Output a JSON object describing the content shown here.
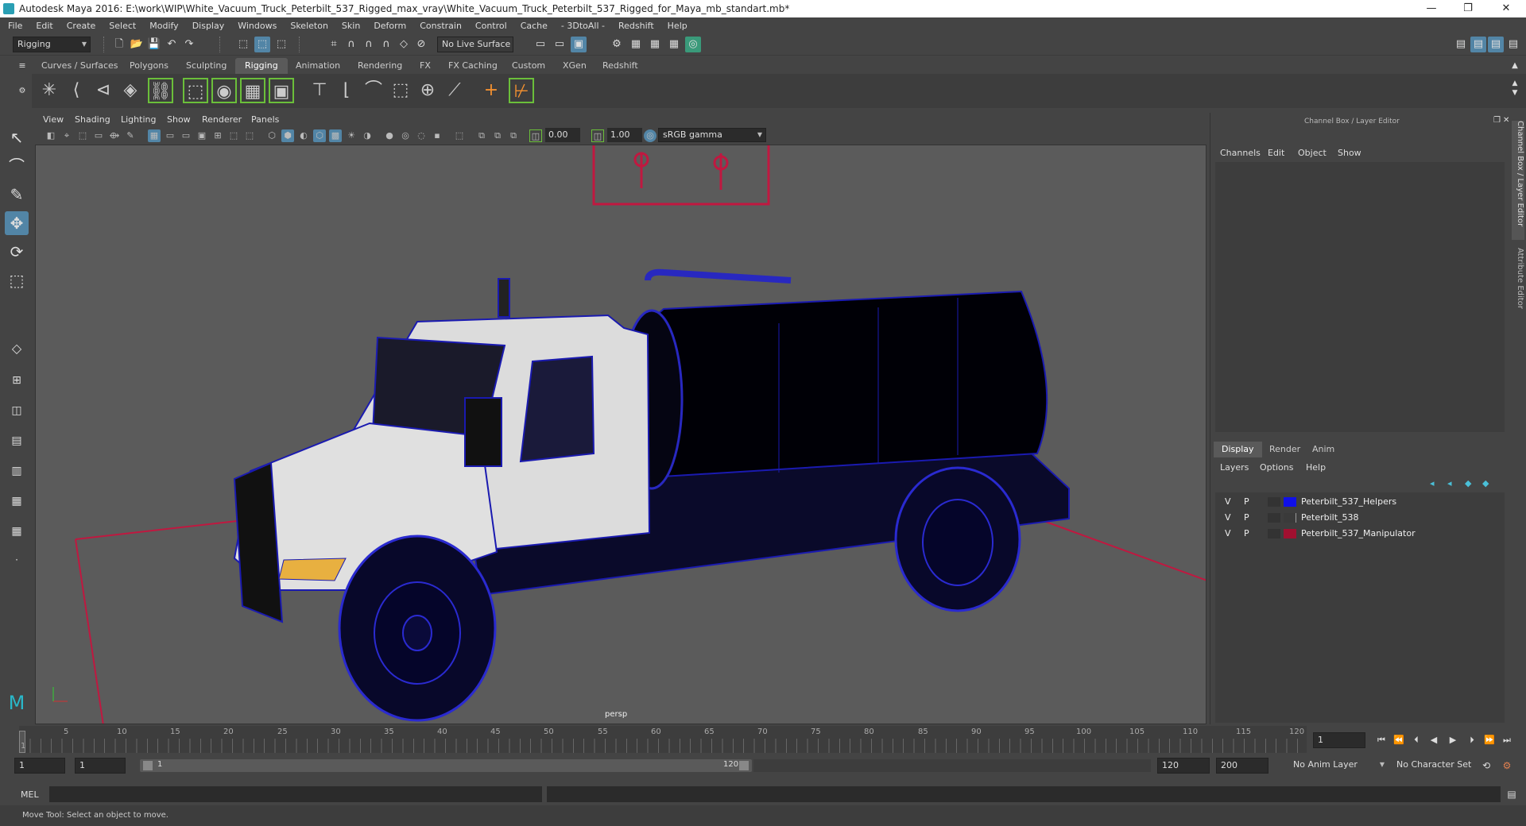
{
  "titlebar": {
    "title": "Autodesk Maya 2016: E:\\work\\WIP\\White_Vacuum_Truck_Peterbilt_537_Rigged_max_vray\\White_Vacuum_Truck_Peterbilt_537_Rigged_for_Maya_mb_standart.mb*",
    "minimize": "—",
    "restore": "❐",
    "close": "✕"
  },
  "menubar": [
    "File",
    "Edit",
    "Create",
    "Select",
    "Modify",
    "Display",
    "Windows",
    "Skeleton",
    "Skin",
    "Deform",
    "Constrain",
    "Control",
    "Cache",
    "- 3DtoAll -",
    "Redshift",
    "Help"
  ],
  "statusline": {
    "menuset": "Rigging",
    "live_surface": "No Live Surface"
  },
  "shelf_tabs": [
    "Curves / Surfaces",
    "Polygons",
    "Sculpting",
    "Rigging",
    "Animation",
    "Rendering",
    "FX",
    "FX Caching",
    "Custom",
    "XGen",
    "Redshift"
  ],
  "active_shelf_tab": "Rigging",
  "panel_menus": [
    "View",
    "Shading",
    "Lighting",
    "Show",
    "Renderer",
    "Panels"
  ],
  "panel_toolbar": {
    "exposure": "0.00",
    "gamma": "1.00",
    "colorspace": "sRGB gamma"
  },
  "viewport": {
    "camera_label": "persp"
  },
  "channel_box": {
    "header": "Channel Box / Layer Editor",
    "menus": [
      "Channels",
      "Edit",
      "Object",
      "Show"
    ],
    "layer_tabs": [
      "Display",
      "Render",
      "Anim"
    ],
    "layer_menus": [
      "Layers",
      "Options",
      "Help"
    ],
    "layers": [
      {
        "v": "V",
        "p": "P",
        "name": "Peterbilt_537_Helpers",
        "color": "#1010e8"
      },
      {
        "v": "V",
        "p": "P",
        "name": "Peterbilt_538",
        "color": ""
      },
      {
        "v": "V",
        "p": "P",
        "name": "Peterbilt_537_Manipulator",
        "color": "#a01030"
      }
    ]
  },
  "side_tabs": [
    "Channel Box / Layer Editor",
    "Attribute Editor"
  ],
  "timeline": {
    "ticks": [
      "1",
      "5",
      "10",
      "15",
      "20",
      "25",
      "30",
      "35",
      "40",
      "45",
      "50",
      "55",
      "60",
      "65",
      "70",
      "75",
      "80",
      "85",
      "90",
      "95",
      "100",
      "105",
      "110",
      "115",
      "120"
    ],
    "current_frame": "1"
  },
  "range": {
    "start": "1",
    "playback_start": "1",
    "slider_start": "1",
    "slider_end": "120",
    "playback_end": "120",
    "end": "200",
    "anim_layer": "No Anim Layer",
    "character_set": "No Character Set"
  },
  "command_line": {
    "label": "MEL"
  },
  "help_line": "Move Tool: Select an object to move."
}
